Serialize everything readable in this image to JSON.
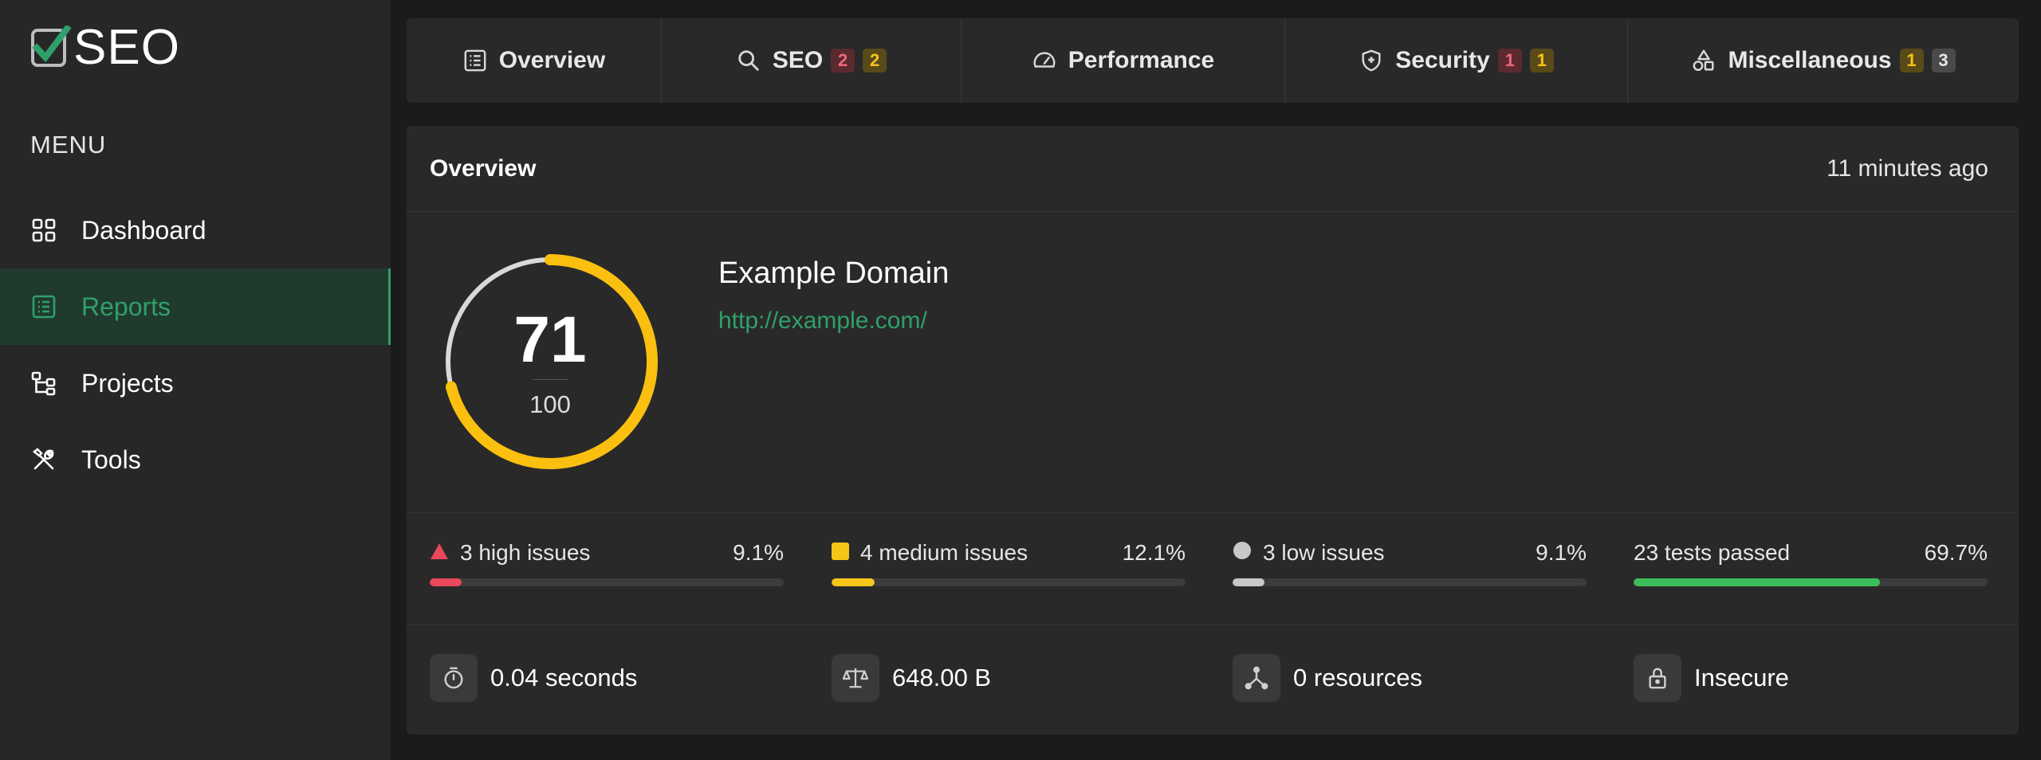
{
  "logo": {
    "text": "SEO"
  },
  "sidebar": {
    "menu_heading": "MENU",
    "items": [
      {
        "label": "Dashboard",
        "icon": "grid-icon"
      },
      {
        "label": "Reports",
        "icon": "report-list-icon",
        "active": true
      },
      {
        "label": "Projects",
        "icon": "project-tree-icon"
      },
      {
        "label": "Tools",
        "icon": "tools-icon"
      }
    ]
  },
  "tabs": [
    {
      "label": "Overview",
      "icon": "list-icon",
      "badges": []
    },
    {
      "label": "SEO",
      "icon": "search-icon",
      "badges": [
        {
          "value": "2",
          "color": "red"
        },
        {
          "value": "2",
          "color": "yellow"
        }
      ]
    },
    {
      "label": "Performance",
      "icon": "speedometer-icon",
      "badges": []
    },
    {
      "label": "Security",
      "icon": "shield-icon",
      "badges": [
        {
          "value": "1",
          "color": "red"
        },
        {
          "value": "1",
          "color": "yellow"
        }
      ]
    },
    {
      "label": "Miscellaneous",
      "icon": "shapes-icon",
      "badges": [
        {
          "value": "1",
          "color": "yellow"
        },
        {
          "value": "3",
          "color": "gray"
        }
      ]
    }
  ],
  "overview": {
    "title": "Overview",
    "time": "11 minutes ago",
    "score": "71",
    "score_max": "100",
    "score_fraction": 0.71,
    "site_name": "Example Domain",
    "site_url": "http://example.com/"
  },
  "issues": [
    {
      "label": "3 high issues",
      "percent": "9.1%",
      "fraction": 0.091,
      "color": "#e8485b",
      "marker": "triangle"
    },
    {
      "label": "4 medium issues",
      "percent": "12.1%",
      "fraction": 0.121,
      "color": "#f5c518",
      "marker": "square"
    },
    {
      "label": "3 low issues",
      "percent": "9.1%",
      "fraction": 0.091,
      "color": "#c8c8c8",
      "marker": "circle"
    },
    {
      "label": "23 tests passed",
      "percent": "69.7%",
      "fraction": 0.697,
      "color": "#3cbf5a",
      "marker": "none"
    }
  ],
  "stats": [
    {
      "label": "0.04 seconds",
      "icon": "stopwatch-icon"
    },
    {
      "label": "648.00 B",
      "icon": "scale-icon"
    },
    {
      "label": "0 resources",
      "icon": "network-icon"
    },
    {
      "label": "Insecure",
      "icon": "lock-icon"
    }
  ],
  "colors": {
    "accent": "#2fa06a",
    "gauge": "#fbbf0f",
    "gauge_track": "#d9d9d9"
  }
}
